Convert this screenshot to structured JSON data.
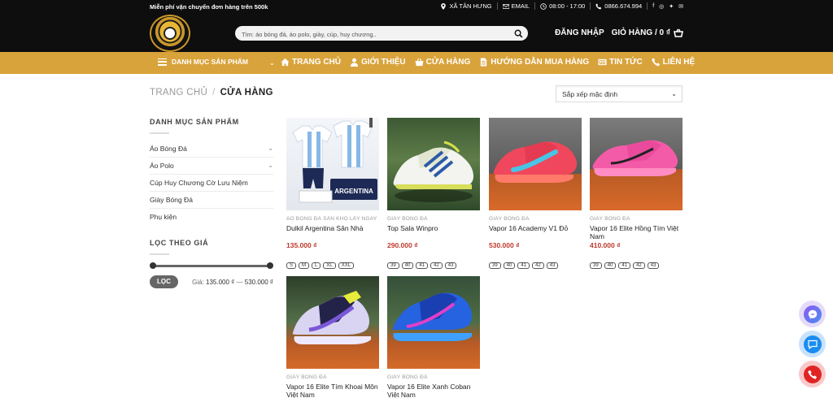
{
  "topbar": {
    "promo": "Miễn phí vận chuyển đơn hàng trên 500k",
    "location": "XÃ TÂN HƯNG",
    "email": "EMAIL",
    "hours": "08:00 - 17:00",
    "phone": "0866.674.994"
  },
  "header": {
    "search_placeholder": "Tìm: áo bóng đá, áo polo, giày, cúp, huy chương..",
    "login": "ĐĂNG NHẬP",
    "cart": "GIỎ HÀNG / 0 ₫"
  },
  "nav": {
    "categories": "DANH MỤC SẢN PHẨM",
    "items": [
      {
        "label": "TRANG CHỦ",
        "icon": "home-icon"
      },
      {
        "label": "GIỚI THIỆU",
        "icon": "user-icon"
      },
      {
        "label": "CỬA HÀNG",
        "icon": "basket-icon"
      },
      {
        "label": "HƯỚNG DẪN MUA HÀNG",
        "icon": "document-icon"
      },
      {
        "label": "TIN TỨC",
        "icon": "newspaper-icon"
      },
      {
        "label": "LIÊN HỆ",
        "icon": "phone-icon"
      }
    ]
  },
  "breadcrumb": {
    "home": "TRANG CHỦ",
    "sep": "/",
    "current": "CỬA HÀNG"
  },
  "sort": {
    "selected": "Sắp xếp mặc định"
  },
  "sidebar": {
    "categories_title": "DANH MỤC SẢN PHẨM",
    "categories": [
      {
        "label": "Áo Bóng Đá"
      },
      {
        "label": "Áo Polo"
      },
      {
        "label": "Cúp Huy Chương Cờ Lưu Niệm"
      },
      {
        "label": "Giày Bóng Đá"
      },
      {
        "label": "Phụ kiện"
      }
    ],
    "filter_title": "LỌC THEO GIÁ",
    "filter_button": "LỌC",
    "price_label": "Giá:",
    "price_min": "135.000 ₫",
    "price_dash": "—",
    "price_max": "530.000 ₫"
  },
  "products": [
    {
      "category": "ÁO BÓNG ĐÁ SÂN KHO LẤY NGAY",
      "title": "Dulkil Argentina Sân Nhà",
      "price": "135.000 ₫",
      "sizes": [
        "S",
        "M",
        "L",
        "XL",
        "XXL"
      ],
      "image": "jersey"
    },
    {
      "category": "GIÀY BÓNG ĐÁ",
      "title": "Top Sala Winpro",
      "price": "290.000 ₫",
      "sizes": [
        "39",
        "40",
        "41",
        "42",
        "43"
      ],
      "image": "white-shoe"
    },
    {
      "category": "GIÀY BÓNG ĐÁ",
      "title": "Vapor 16 Academy V1 Đỏ",
      "price": "530.000 ₫",
      "sizes": [
        "39",
        "40",
        "41",
        "42",
        "43"
      ],
      "image": "red-shoe"
    },
    {
      "category": "GIÀY BÓNG ĐÁ",
      "title": "Vapor 16 Elite Hồng Tím Việt Nam",
      "price": "410.000 ₫",
      "sizes": [
        "39",
        "40",
        "41",
        "42",
        "43"
      ],
      "image": "pink-shoe"
    },
    {
      "category": "GIÀY BÓNG ĐÁ",
      "title": "Vapor 16 Elite Tím Khoai Môn Việt Nam",
      "price": "",
      "sizes": [],
      "image": "purple-shoe"
    },
    {
      "category": "GIÀY BÓNG ĐÁ",
      "title": "Vapor 16 Elite Xanh Coban Việt Nam",
      "price": "",
      "sizes": [],
      "image": "blue-shoe"
    }
  ],
  "jersey_text": "ARGENTINA",
  "colors": {
    "accent": "#d9a33b",
    "price": "#c0392b",
    "dark": "#0e0e0e"
  }
}
